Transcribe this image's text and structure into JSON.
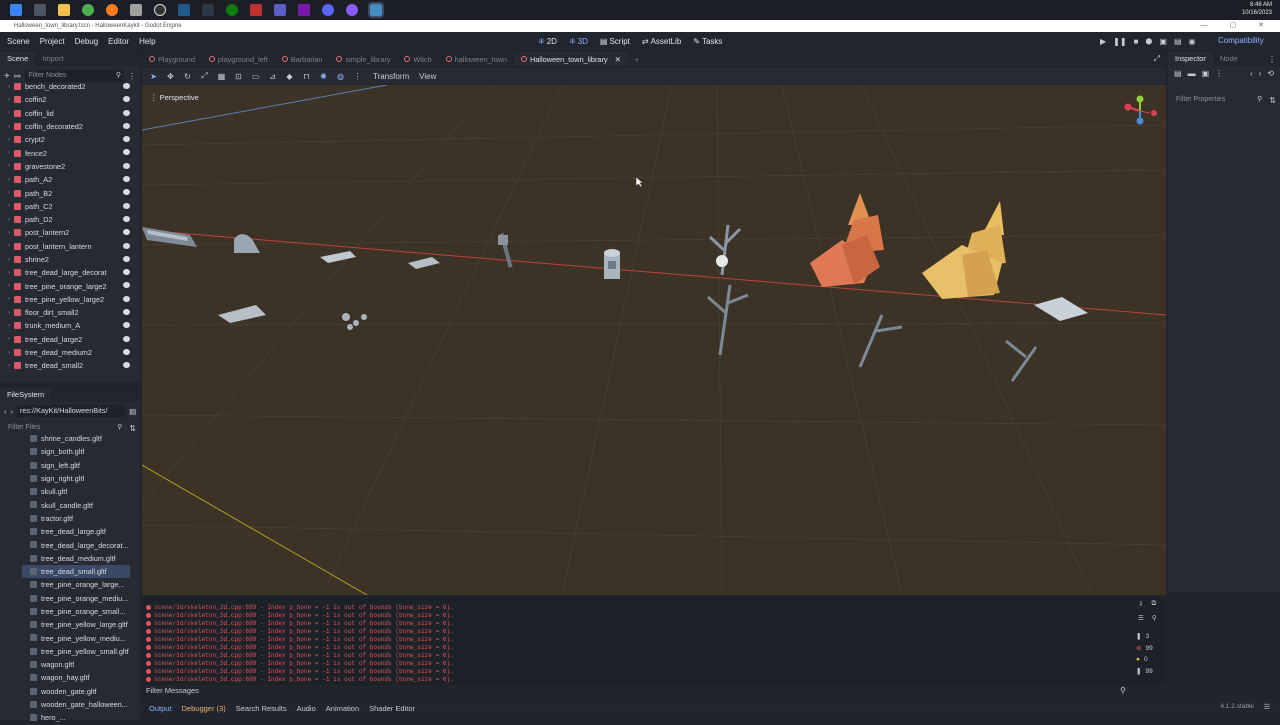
{
  "taskbar": {
    "icons": [
      "start-icon",
      "task-view-icon",
      "file-explorer-icon",
      "chrome-icon",
      "firefox-icon",
      "app-icon",
      "obs-icon",
      "steam-icon",
      "terminal-icon",
      "xbox-icon",
      "app2-icon",
      "teams-icon",
      "onenote-icon",
      "discord-icon",
      "github-icon",
      "godot-icon"
    ],
    "time": "8:46 AM",
    "date": "10/16/2023"
  },
  "window": {
    "title": "Halloween_town_library.tscn - HalloweenKaykit - Godot Engine"
  },
  "menu": {
    "scene": "Scene",
    "project": "Project",
    "debug": "Debug",
    "editor": "Editor",
    "help": "Help"
  },
  "workspaces": {
    "w2d": "2D",
    "w3d": "3D",
    "script": "Script",
    "assetlib": "AssetLib",
    "tasks": "Tasks"
  },
  "renderer": "Compatibility",
  "scene_dock": {
    "tab_scene": "Scene",
    "tab_import": "Import",
    "filter_placeholder": "Filter Nodes",
    "nodes": [
      "bench_decorated2",
      "coffin2",
      "coffin_lid",
      "coffin_decorated2",
      "crypt2",
      "fence2",
      "gravestone2",
      "path_A2",
      "path_B2",
      "path_C2",
      "path_D2",
      "post_lantern2",
      "post_lantern_lantern",
      "shrine2",
      "tree_dead_large_decorat",
      "tree_pine_orange_large2",
      "tree_pine_yellow_large2",
      "floor_dirt_small2",
      "trunk_medium_A",
      "tree_dead_large2",
      "tree_dead_medium2",
      "tree_dead_small2"
    ]
  },
  "filesystem": {
    "title": "FileSystem",
    "path": "res://KayKit/HalloweenBits/",
    "filter_placeholder": "Filter Files",
    "files": [
      "shrine_candles.gltf",
      "sign_both.gltf",
      "sign_left.gltf",
      "sign_right.gltf",
      "skull.gltf",
      "skull_candle.gltf",
      "tractor.gltf",
      "tree_dead_large.gltf",
      "tree_dead_large_decorat...",
      "tree_dead_medium.gltf",
      "tree_dead_small.gltf",
      "tree_pine_orange_large...",
      "tree_pine_orange_mediu...",
      "tree_pine_orange_small...",
      "tree_pine_yellow_large.gltf",
      "tree_pine_yellow_mediu...",
      "tree_pine_yellow_small.gltf",
      "wagon.gltf",
      "wagon_hay.gltf",
      "wooden_gate.gltf",
      "wooden_gate_halloween...",
      "hero_..."
    ],
    "selected_index": 10
  },
  "editor_tabs": [
    {
      "label": "Playground",
      "active": false
    },
    {
      "label": "playground_left",
      "active": false
    },
    {
      "label": "Barbarian",
      "active": false
    },
    {
      "label": "simple_library",
      "active": false
    },
    {
      "label": "Witch",
      "active": false
    },
    {
      "label": "halloween_town",
      "active": false
    },
    {
      "label": "Halloween_town_library",
      "active": true
    }
  ],
  "toolbar": {
    "transform": "Transform",
    "view": "View"
  },
  "viewport": {
    "perspective": "Perspective"
  },
  "inspector": {
    "tab_inspector": "Inspector",
    "tab_node": "Node",
    "filter_placeholder": "Filter Properties"
  },
  "output": {
    "lines": [
      "scene/3d/skeleton_3d.cpp:699 - Index p_bone = -1 is out of bounds (bone_size = 6).",
      "scene/3d/skeleton_3d.cpp:699 - Index p_bone = -1 is out of bounds (bone_size = 6).",
      "scene/3d/skeleton_3d.cpp:699 - Index p_bone = -1 is out of bounds (bone_size = 6).",
      "scene/3d/skeleton_3d.cpp:699 - Index p_bone = -1 is out of bounds (bone_size = 6).",
      "scene/3d/skeleton_3d.cpp:699 - Index p_bone = -1 is out of bounds (bone_size = 6).",
      "scene/3d/skeleton_3d.cpp:699 - Index p_bone = -1 is out of bounds (bone_size = 6).",
      "scene/3d/skeleton_3d.cpp:699 - Index p_bone = -1 is out of bounds (bone_size = 6).",
      "scene/3d/skeleton_3d.cpp:699 - Index p_bone = -1 is out of bounds (bone_size = 6).",
      "scene/3d/skeleton_3d.cpp:699 - Index p_bone = -1 is out of bounds (bone_size = 6).",
      "scene/3d/skeleton_3d.cpp:699 - Index p_bone = -1 is out of bounds (bone_size = 6)."
    ],
    "filter_placeholder": "Filter Messages",
    "count_log": "3",
    "count_errors": "99",
    "count_warnings": "0",
    "count_other": "99"
  },
  "bottom_tabs": {
    "output": "Output",
    "debugger": "Debugger (3)",
    "search": "Search Results",
    "audio": "Audio",
    "animation": "Animation",
    "shader": "Shader Editor"
  },
  "version": "4.1.2.stable"
}
